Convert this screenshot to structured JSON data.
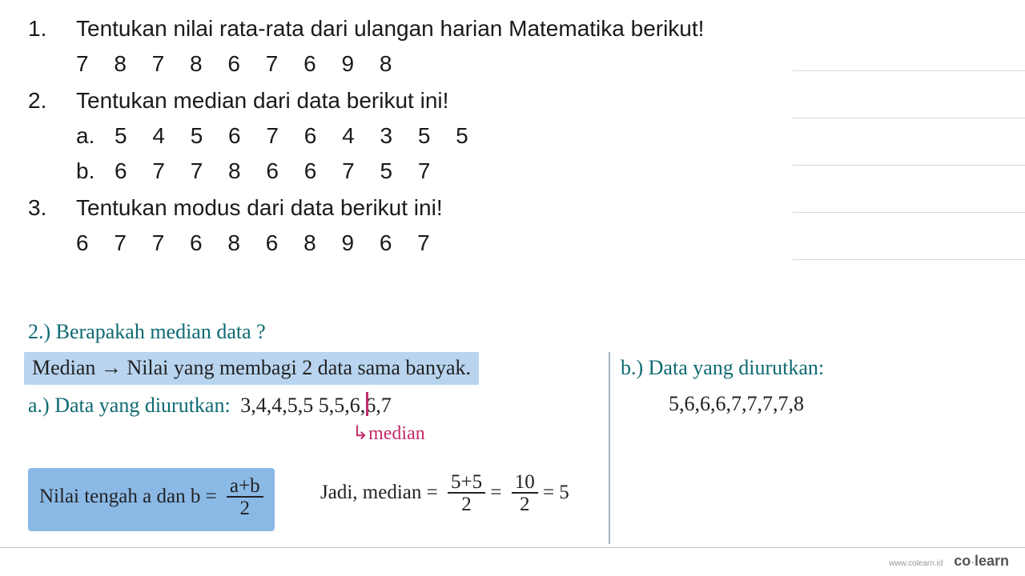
{
  "questions": {
    "q1": {
      "num": "1.",
      "text": "Tentukan nilai rata-rata dari ulangan harian Matematika berikut!",
      "data": "7  8  7  8  6  7  6  9  8"
    },
    "q2": {
      "num": "2.",
      "text": "Tentukan median dari data berikut ini!",
      "a_label": "a.",
      "a_data": "5  4  5  6  7  6  4  3  5  5",
      "b_label": "b.",
      "b_data": "6  7  7  8  6  6  7  5  7"
    },
    "q3": {
      "num": "3.",
      "text": "Tentukan modus dari data berikut ini!",
      "data": "6  7  7  6  8  6  8  9  6  7"
    }
  },
  "work": {
    "heading": "2.) Berapakah median data ?",
    "definition": "Median → Nilai yang membagi 2 data sama banyak.",
    "a_label": "a.) Data yang diurutkan:",
    "a_sorted": "3,4,4,5,5 5,5,6,6,7",
    "median_mark": "↳median",
    "formula_label": "Nilai tengah a dan b =",
    "formula_num": "a+b",
    "formula_den": "2",
    "jadi_label": "Jadi, median =",
    "jadi_n1": "5+5",
    "jadi_d1": "2",
    "jadi_eq1": "=",
    "jadi_n2": "10",
    "jadi_d2": "2",
    "jadi_eq2": "= 5",
    "b_label": "b.) Data yang diurutkan:",
    "b_sorted": "5,6,6,6,7,7,7,7,8"
  },
  "brand": {
    "url": "www.colearn.id",
    "name_a": "co",
    "name_b": "learn"
  }
}
